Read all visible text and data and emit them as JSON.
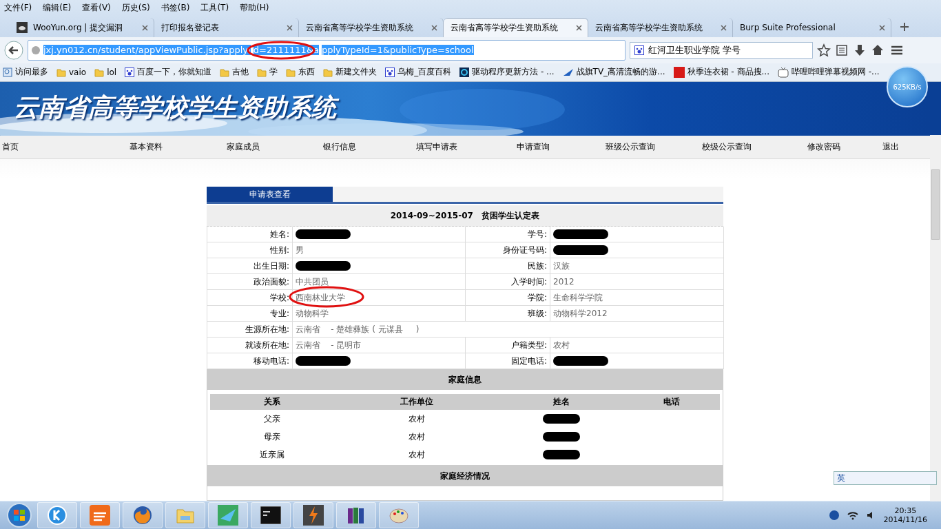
{
  "menu_bar": [
    "文件(F)",
    "编辑(E)",
    "查看(V)",
    "历史(S)",
    "书签(B)",
    "工具(T)",
    "帮助(H)"
  ],
  "tabs": [
    {
      "label": "WooYun.org | 提交漏洞",
      "selected": false,
      "icon": true
    },
    {
      "label": "打印报名登记表",
      "selected": false,
      "icon": false
    },
    {
      "label": "云南省高等学校学生资助系统",
      "selected": false,
      "icon": false
    },
    {
      "label": "云南省高等学校学生资助系统",
      "selected": true,
      "icon": false
    },
    {
      "label": "云南省高等学校学生资助系统",
      "selected": false,
      "icon": false
    },
    {
      "label": "Burp Suite Professional",
      "selected": false,
      "icon": false
    }
  ],
  "address_bar": {
    "before": "jxj.yn012.cn/student/appViewPublic.jsp?applyI",
    "circled_text": "d=2111111&a",
    "after": "pplyTypeId=1&publicType=school",
    "circled": true
  },
  "search_field": {
    "value": "红河卫生职业学院 学号"
  },
  "bookmarks": [
    {
      "label": "访问最多",
      "kind": "smart"
    },
    {
      "label": "vaio",
      "kind": "folder"
    },
    {
      "label": "lol",
      "kind": "folder"
    },
    {
      "label": "百度一下，你就知道",
      "kind": "paw"
    },
    {
      "label": "吉他",
      "kind": "folder"
    },
    {
      "label": "学",
      "kind": "folder"
    },
    {
      "label": "东西",
      "kind": "folder"
    },
    {
      "label": "新建文件夹",
      "kind": "folder"
    },
    {
      "label": "乌梅_百度百科",
      "kind": "paw"
    },
    {
      "label": "驱动程序更新方法 - ...",
      "kind": "app"
    },
    {
      "label": "战旗TV_高清流畅的游...",
      "kind": "plane"
    },
    {
      "label": "秋季连衣裙 - 商品搜...",
      "kind": "jd"
    },
    {
      "label": "哔哩哔哩弹幕视频网 -...",
      "kind": "tv"
    }
  ],
  "speed_badge": "625KB/s",
  "site": {
    "title": "云南省高等学校学生资助系统",
    "nav": [
      "首页",
      "基本资料",
      "家庭成员",
      "银行信息",
      "填写申请表",
      "申请查询",
      "班级公示查询",
      "校级公示查询",
      "修改密码",
      "退出"
    ]
  },
  "panel": {
    "tab": "申请表查看",
    "form_title": "2014-09~2015-07   贫困学生认定表",
    "fields": [
      [
        {
          "label": "姓名:",
          "redacted": true
        },
        {
          "label": "学号:",
          "redacted": true
        }
      ],
      [
        {
          "label": "性别:",
          "value": "男",
          "redacted": false
        },
        {
          "label": "身份证号码:",
          "redacted": true
        }
      ],
      [
        {
          "label": "出生日期:",
          "redacted": true
        },
        {
          "label": "民族:",
          "value": "汉族",
          "redacted": false
        }
      ],
      [
        {
          "label": "政治面貌:",
          "value": "中共团员",
          "redacted": false
        },
        {
          "label": "入学时间:",
          "value": "2012",
          "redacted": false
        }
      ],
      [
        {
          "label": "学校:",
          "value": "西南林业大学",
          "redacted": false,
          "circled": true
        },
        {
          "label": "学院:",
          "value": "生命科学学院",
          "redacted": false
        }
      ],
      [
        {
          "label": "专业:",
          "value": "动物科学",
          "redacted": false
        },
        {
          "label": "班级:",
          "value": "动物科学2012",
          "redacted": false
        }
      ],
      [
        {
          "label": "生源所在地:",
          "value": "云南省    - 楚雄彝族 ( 元谋县     )",
          "redacted": false
        }
      ],
      [
        {
          "label": "就读所在地:",
          "value": "云南省    - 昆明市",
          "redacted": false
        },
        {
          "label": "户籍类型:",
          "value": "农村",
          "redacted": false
        }
      ],
      [
        {
          "label": "移动电话:",
          "redacted": true
        },
        {
          "label": "固定电话:",
          "redacted": true
        }
      ]
    ],
    "family_title": "家庭信息",
    "family_columns": [
      "关系",
      "工作单位",
      "姓名",
      "电话"
    ],
    "family_rows": [
      {
        "relation": "父亲",
        "work": "农村",
        "name_redacted": true
      },
      {
        "relation": "母亲",
        "work": "农村",
        "name_redacted": true
      },
      {
        "relation": "近亲属",
        "work": "农村",
        "name_redacted": true
      }
    ],
    "economy_title": "家庭经济情况"
  },
  "ime_bar": {
    "label": "英"
  },
  "taskbar": {
    "apps": [
      {
        "kind": "k"
      },
      {
        "kind": "stripes"
      },
      {
        "kind": "firefox"
      },
      {
        "kind": "explorer"
      },
      {
        "kind": "bird"
      },
      {
        "kind": "cmd"
      },
      {
        "kind": "burp"
      },
      {
        "kind": "winrar"
      },
      {
        "kind": "paint"
      }
    ],
    "time": "20:35",
    "date": "2014/11/16"
  }
}
